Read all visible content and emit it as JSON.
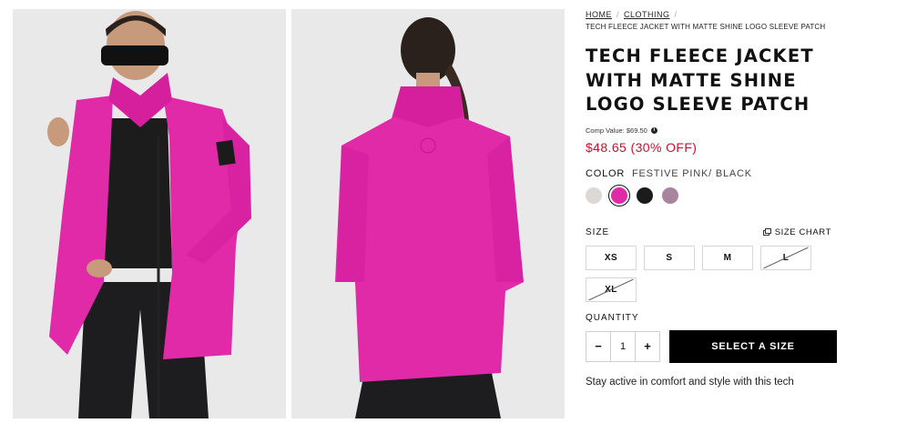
{
  "breadcrumb": {
    "items": [
      "HOME",
      "CLOTHING"
    ],
    "separator": "/",
    "current": "TECH FLEECE JACKET WITH MATTE SHINE LOGO SLEEVE PATCH"
  },
  "product": {
    "title": "TECH FLEECE JACKET WITH MATTE SHINE LOGO SLEEVE PATCH",
    "comp_value": "Comp Value: $69.50",
    "info_icon": "info-icon",
    "price": "$48.65 (30% OFF)",
    "description": "Stay active in comfort and style with this tech"
  },
  "color": {
    "label": "COLOR",
    "selected": "FESTIVE PINK/ BLACK",
    "swatches": [
      {
        "name": "light-gray",
        "color": "#dcd8d5"
      },
      {
        "name": "festive-pink",
        "color": "#e02aa8",
        "selected": true
      },
      {
        "name": "black",
        "color": "#1c1c1c"
      },
      {
        "name": "mauve",
        "color": "#a8849d"
      }
    ]
  },
  "size": {
    "label": "SIZE",
    "chart_label": "SIZE CHART",
    "options": [
      {
        "label": "XS",
        "available": true
      },
      {
        "label": "S",
        "available": true
      },
      {
        "label": "M",
        "available": true
      },
      {
        "label": "L",
        "available": false
      },
      {
        "label": "XL",
        "available": false
      }
    ]
  },
  "quantity": {
    "label": "QUANTITY",
    "minus": "−",
    "value": "1",
    "plus": "+"
  },
  "cta": {
    "label": "SELECT A SIZE"
  },
  "images": [
    {
      "name": "front-view-photo"
    },
    {
      "name": "back-view-photo"
    }
  ],
  "colors": {
    "accent_price": "#c8102e",
    "jacket": "#e02aa8",
    "button": "#000000"
  }
}
